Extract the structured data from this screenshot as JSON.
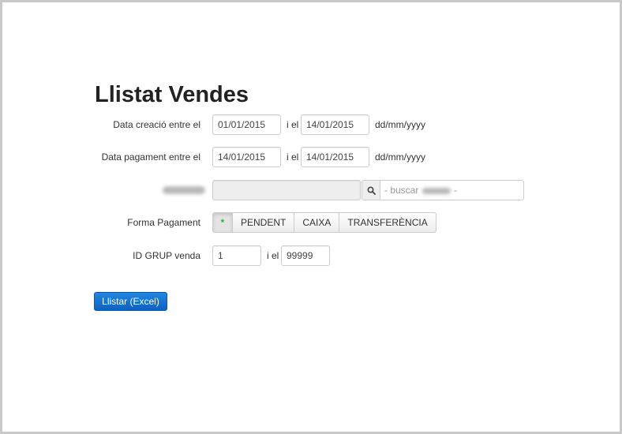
{
  "page": {
    "title": "Llistat Vendes"
  },
  "filters": {
    "creation_date": {
      "label": "Data creació entre el",
      "from": "01/01/2015",
      "separator": "i el",
      "to": "14/01/2015",
      "format_hint": "dd/mm/yyyy"
    },
    "payment_date": {
      "label": "Data pagament entre el",
      "from": "14/01/2015",
      "separator": "i el",
      "to": "14/01/2015",
      "format_hint": "dd/mm/yyyy"
    },
    "search": {
      "field_value": "",
      "icon": "search-icon",
      "placeholder_prefix": "- buscar",
      "placeholder_suffix": "-"
    },
    "payment_method": {
      "label": "Forma Pagament",
      "options": [
        "*",
        "PENDENT",
        "CAIXA",
        "TRANSFERÈNCIA"
      ],
      "selected": "*"
    },
    "group_id": {
      "label": "ID GRUP venda",
      "from": "1",
      "separator": "i el",
      "to": "99999"
    }
  },
  "actions": {
    "list_button": "Llistar (Excel)"
  },
  "colors": {
    "primary": "#0c62c4",
    "active_option": "#2cb52c"
  }
}
